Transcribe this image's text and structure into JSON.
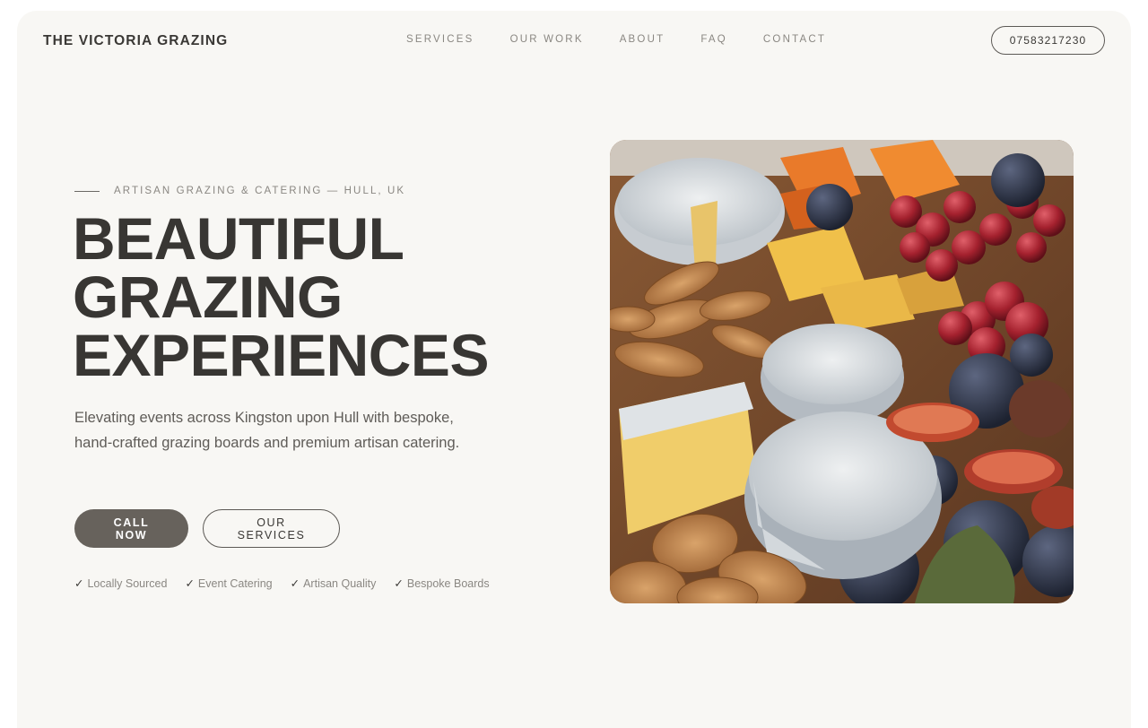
{
  "brand": {
    "name": "THE VICTORIA GRAZING"
  },
  "nav": {
    "items": [
      {
        "label": "SERVICES"
      },
      {
        "label": "OUR WORK"
      },
      {
        "label": "ABOUT"
      },
      {
        "label": "FAQ"
      },
      {
        "label": "CONTACT"
      }
    ],
    "phone": "07583217230"
  },
  "hero": {
    "eyebrow": "ARTISAN GRAZING & CATERING — HULL, UK",
    "headline": [
      "BEAUTIFUL",
      "GRAZING",
      "EXPERIENCES"
    ],
    "lede": "Elevating events across Kingston upon Hull with bespoke, hand-crafted grazing boards and premium artisan catering.",
    "cta_primary": "CALL NOW",
    "cta_secondary": "OUR SERVICES",
    "features": [
      {
        "check": "✓",
        "label": "Locally Sourced"
      },
      {
        "check": "✓",
        "label": "Event Catering"
      },
      {
        "check": "✓",
        "label": "Artisan Quality"
      },
      {
        "check": "✓",
        "label": "Bespoke Boards"
      }
    ]
  },
  "colors": {
    "page_bg": "#f8f7f4",
    "text_dark": "#383633",
    "text_muted": "#8a8782",
    "button_primary": "#67625c"
  }
}
